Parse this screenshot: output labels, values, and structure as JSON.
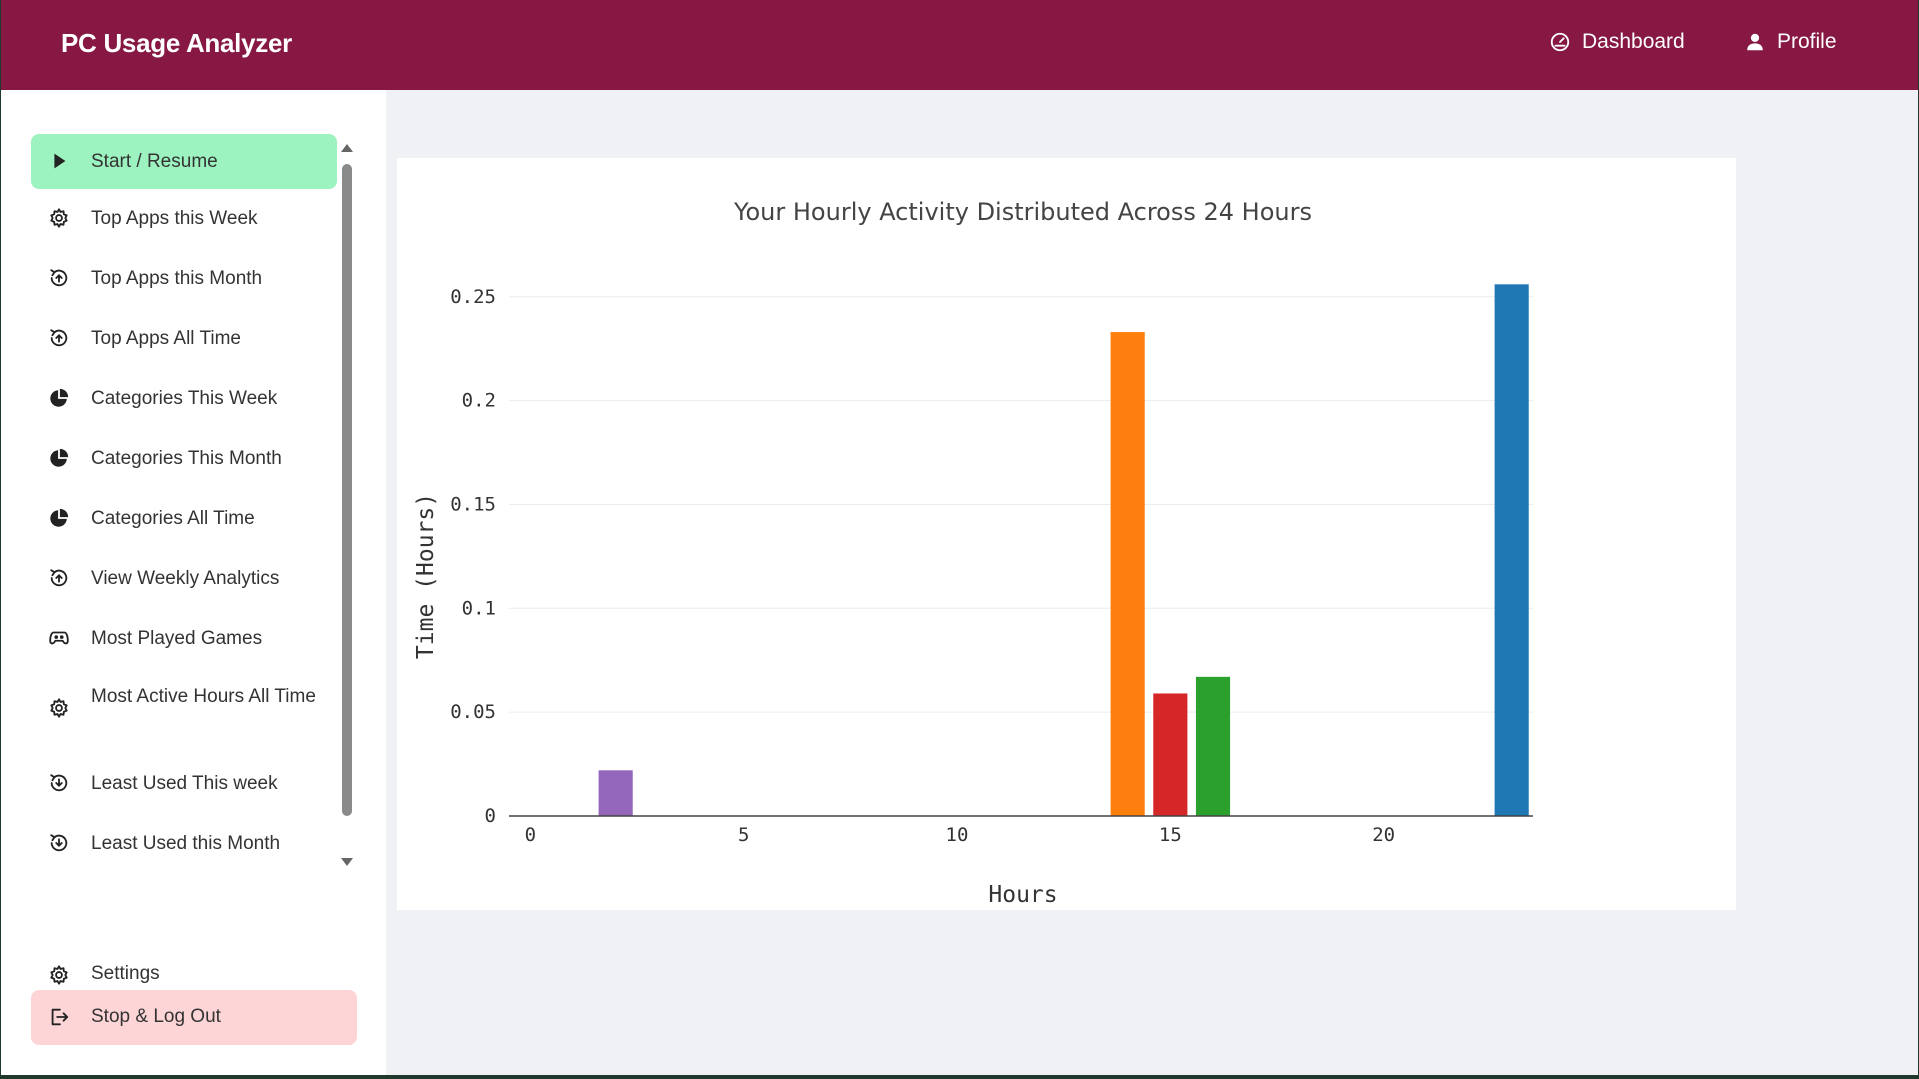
{
  "app": {
    "title": "PC Usage Analyzer"
  },
  "topnav": [
    {
      "label": "Dashboard",
      "icon": "speedometer-icon"
    },
    {
      "label": "Profile",
      "icon": "user-icon"
    }
  ],
  "sidebar": {
    "items": [
      {
        "label": "Start / Resume",
        "icon": "play-icon",
        "active": true
      },
      {
        "label": "Top Apps this Week",
        "icon": "gear-icon"
      },
      {
        "label": "Top Apps this Month",
        "icon": "history-icon"
      },
      {
        "label": "Top Apps All Time",
        "icon": "history-icon"
      },
      {
        "label": "Categories This Week",
        "icon": "pie-chart-icon"
      },
      {
        "label": "Categories This Month",
        "icon": "pie-chart-icon"
      },
      {
        "label": "Categories All Time",
        "icon": "pie-chart-icon"
      },
      {
        "label": "View Weekly Analytics",
        "icon": "history-icon"
      },
      {
        "label": "Most Played Games",
        "icon": "gamepad-icon"
      },
      {
        "label": "Most Active Hours All Time",
        "icon": "gear-icon"
      },
      {
        "label": "Least Used This week",
        "icon": "clock-down-icon"
      },
      {
        "label": "Least Used this Month",
        "icon": "clock-down-icon"
      }
    ],
    "settings": {
      "label": "Settings",
      "icon": "gear-icon"
    },
    "logout": {
      "label": "Stop & Log Out",
      "icon": "logout-icon"
    }
  },
  "colors": {
    "topbar": "#861843",
    "active_item": "#9cf3bf",
    "logout_item": "#fdd5d7"
  },
  "chart_data": {
    "type": "bar",
    "title": "Your Hourly Activity Distributed Across 24 Hours",
    "xlabel": "Hours",
    "ylabel": "Time (Hours)",
    "xlim": [
      -0.5,
      23.5
    ],
    "ylim": [
      0,
      0.26
    ],
    "xticks": [
      0,
      5,
      10,
      15,
      20
    ],
    "yticks": [
      {
        "value": 0,
        "label": "0"
      },
      {
        "value": 0.05,
        "label": "0.05"
      },
      {
        "value": 0.1,
        "label": "0.1"
      },
      {
        "value": 0.15,
        "label": "0.15"
      },
      {
        "value": 0.2,
        "label": "0.2"
      },
      {
        "value": 0.25,
        "label": "0.25"
      }
    ],
    "grid": true,
    "bars": [
      {
        "x": 2,
        "value": 0.022,
        "color": "#9467bd"
      },
      {
        "x": 14,
        "value": 0.233,
        "color": "#ff7f0e"
      },
      {
        "x": 15,
        "value": 0.059,
        "color": "#d62728"
      },
      {
        "x": 16,
        "value": 0.067,
        "color": "#2ca02c"
      },
      {
        "x": 23,
        "value": 0.256,
        "color": "#1f77b4"
      }
    ]
  }
}
